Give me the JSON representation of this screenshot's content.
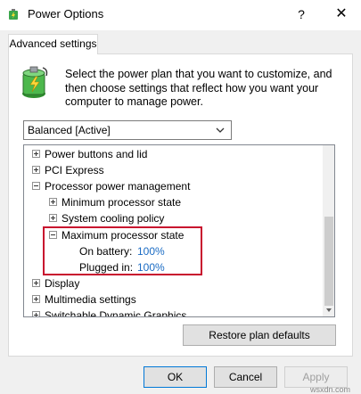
{
  "window": {
    "title": "Power Options",
    "help_icon": "?",
    "close_icon": "✕"
  },
  "tab": {
    "label": "Advanced settings"
  },
  "description": "Select the power plan that you want to customize, and then choose settings that reflect how you want your computer to manage power.",
  "plan_select": {
    "value": "Balanced [Active]"
  },
  "tree": {
    "items": [
      {
        "label": "Power buttons and lid",
        "expander": "plus"
      },
      {
        "label": "PCI Express",
        "expander": "plus"
      },
      {
        "label": "Processor power management",
        "expander": "minus"
      },
      {
        "label": "Minimum processor state",
        "expander": "plus"
      },
      {
        "label": "System cooling policy",
        "expander": "plus"
      },
      {
        "label": "Maximum processor state",
        "expander": "minus"
      },
      {
        "label": "On battery:",
        "value": "100%"
      },
      {
        "label": "Plugged in:",
        "value": "100%"
      },
      {
        "label": "Display",
        "expander": "plus"
      },
      {
        "label": "Multimedia settings",
        "expander": "plus"
      },
      {
        "label": "Switchable Dynamic Graphics",
        "expander": "plus"
      }
    ]
  },
  "buttons": {
    "restore": "Restore plan defaults",
    "ok": "OK",
    "cancel": "Cancel",
    "apply": "Apply"
  },
  "watermark": "wsxdn.com",
  "colors": {
    "highlight_border": "#c8102e",
    "value_text": "#1a6bc4"
  }
}
